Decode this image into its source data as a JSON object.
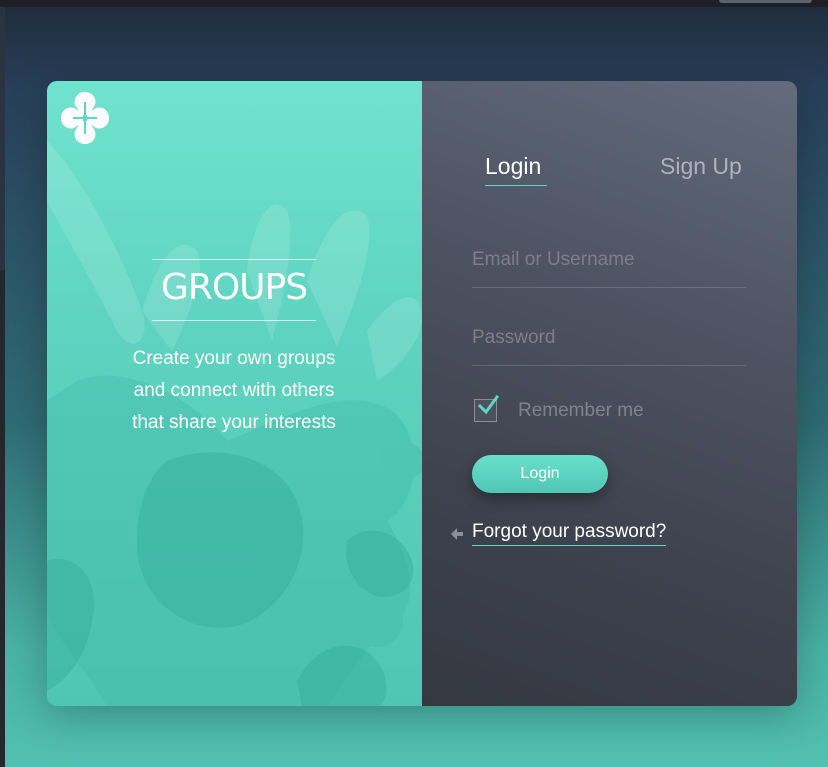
{
  "brand": {
    "title": "GROUPS",
    "tagline_line1": "Create your own groups",
    "tagline_line2": "and connect with others",
    "tagline_line3": "that share your interests",
    "logo_icon": "clover-logo-icon",
    "accent_color": "#5fd6c3"
  },
  "tabs": {
    "login_label": "Login",
    "signup_label": "Sign Up",
    "active": "login"
  },
  "form": {
    "email_placeholder": "Email or Username",
    "email_value": "",
    "password_placeholder": "Password",
    "password_value": "",
    "remember_label": "Remember me",
    "remember_checked": true,
    "submit_label": "Login",
    "forgot_label": "Forgot your password?",
    "forgot_icon": "arrow-left-icon"
  }
}
